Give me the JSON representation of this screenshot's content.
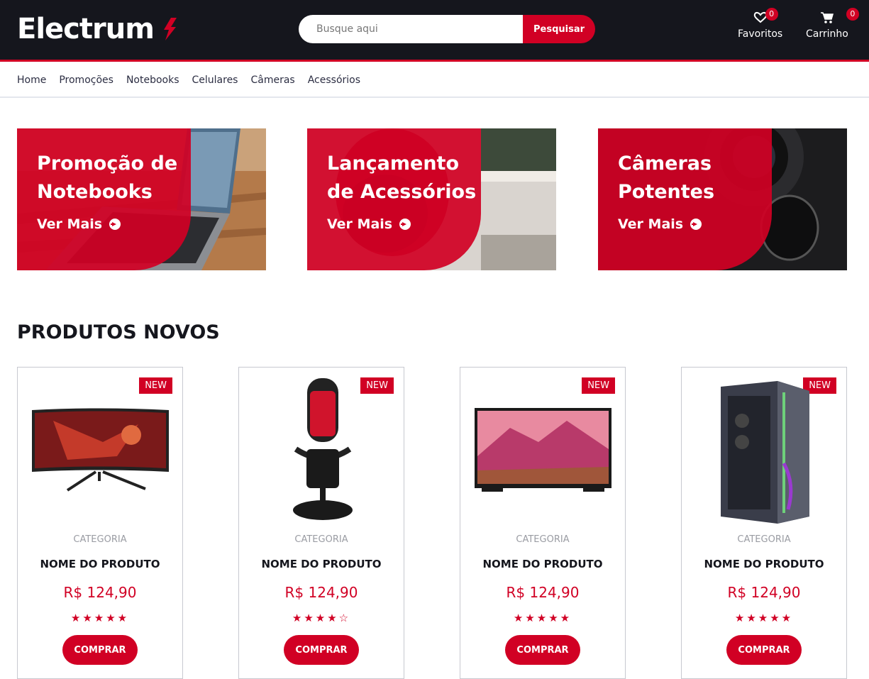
{
  "brand": {
    "name": "Electrum"
  },
  "search": {
    "placeholder": "Busque aqui",
    "button_label": "Pesquisar"
  },
  "header": {
    "favorites": {
      "label": "Favoritos",
      "count": "0"
    },
    "cart": {
      "label": "Carrinho",
      "count": "0"
    }
  },
  "nav": {
    "items": [
      "Home",
      "Promoções",
      "Notebooks",
      "Celulares",
      "Câmeras",
      "Acessórios"
    ]
  },
  "banners": [
    {
      "title": "Promoção de Notebooks",
      "cta": "Ver Mais"
    },
    {
      "title": "Lançamento de Acessórios",
      "cta": "Ver Mais"
    },
    {
      "title": "Câmeras Potentes",
      "cta": "Ver Mais"
    }
  ],
  "section": {
    "title": "PRODUTOS NOVOS"
  },
  "products": [
    {
      "badge": "NEW",
      "category": "CATEGORIA",
      "name": "NOME DO PRODUTO",
      "price": "R$ 124,90",
      "rating": 5,
      "stars": "★★★★★",
      "button": "COMPRAR"
    },
    {
      "badge": "NEW",
      "category": "CATEGORIA",
      "name": "NOME DO PRODUTO",
      "price": "R$ 124,90",
      "rating": 4,
      "stars": "★★★★☆",
      "button": "COMPRAR"
    },
    {
      "badge": "NEW",
      "category": "CATEGORIA",
      "name": "NOME DO PRODUTO",
      "price": "R$ 124,90",
      "rating": 5,
      "stars": "★★★★★",
      "button": "COMPRAR"
    },
    {
      "badge": "NEW",
      "category": "CATEGORIA",
      "name": "NOME DO PRODUTO",
      "price": "R$ 124,90",
      "rating": 5,
      "stars": "★★★★★",
      "button": "COMPRAR"
    }
  ],
  "colors": {
    "accent": "#d10024",
    "header_bg": "#15161d"
  }
}
